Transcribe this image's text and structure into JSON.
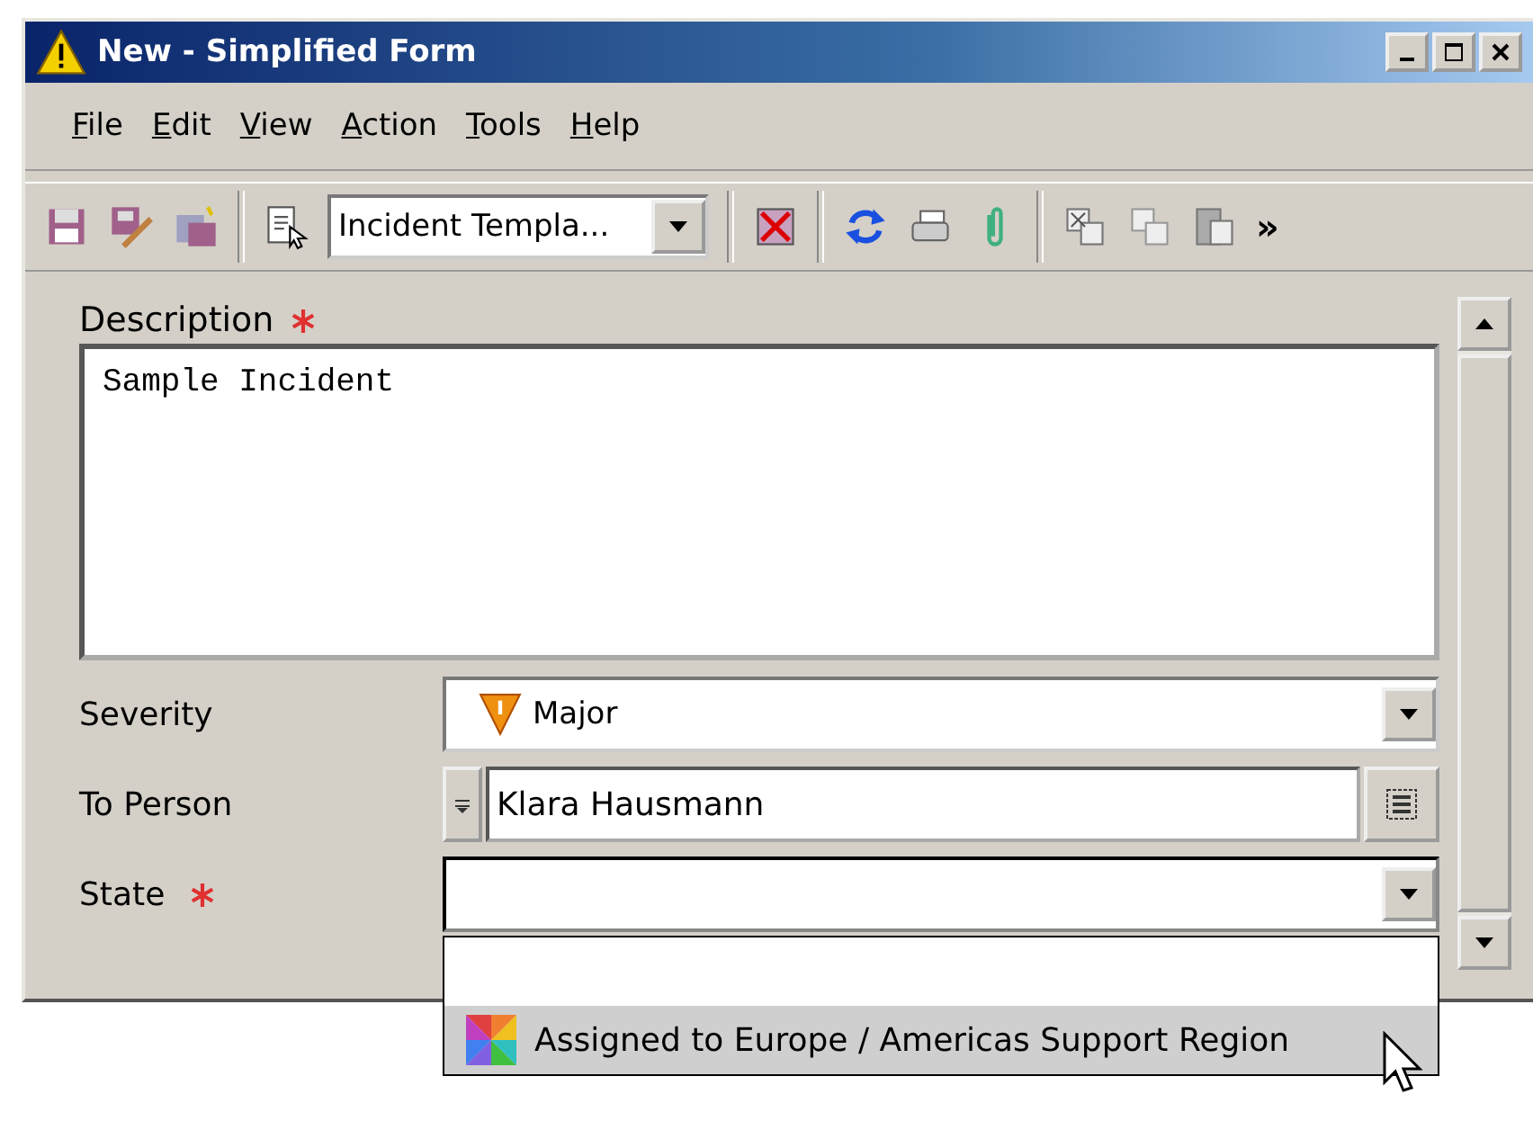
{
  "window": {
    "title": "New - Simplified Form"
  },
  "menu": [
    "File",
    "Edit",
    "View",
    "Action",
    "Tools",
    "Help"
  ],
  "toolbar": {
    "template": "Incident Templa...",
    "overflow": "»"
  },
  "form": {
    "description": {
      "label": "Description",
      "required": true,
      "value": "Sample Incident"
    },
    "severity": {
      "label": "Severity",
      "value": "Major"
    },
    "to_person": {
      "label": "To Person",
      "value": "Klara Hausmann"
    },
    "state": {
      "label": "State",
      "required": true,
      "expanded": true,
      "options": [
        {
          "label": "Assigned to Europe / Americas Support Region",
          "selected": true
        }
      ]
    }
  }
}
